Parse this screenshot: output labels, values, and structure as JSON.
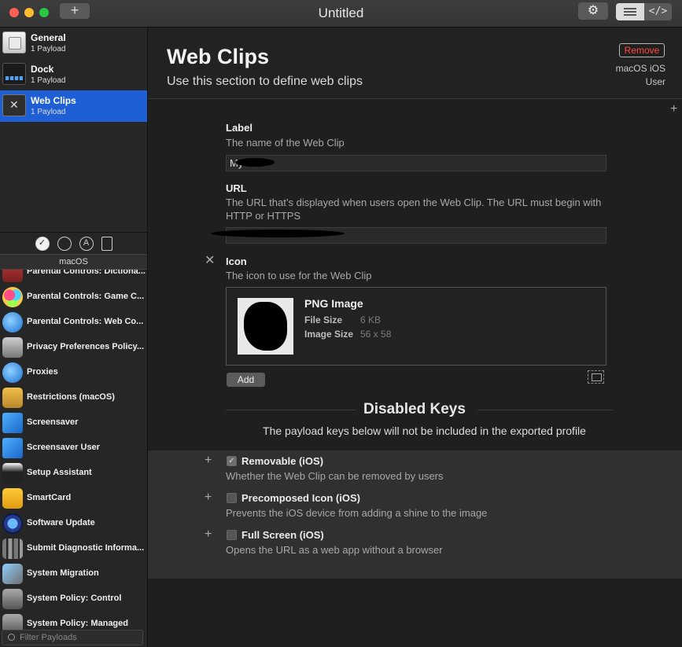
{
  "window": {
    "title": "Untitled",
    "add_label": "+",
    "gear_glyph": "⚙",
    "code_glyph": "</>"
  },
  "payloads": [
    {
      "name": "General",
      "sub": "1 Payload",
      "icon": "general-icon"
    },
    {
      "name": "Dock",
      "sub": "1 Payload",
      "icon": "dock-icon"
    },
    {
      "name": "Web Clips",
      "sub": "1 Payload",
      "icon": "web-clips-icon",
      "selected": true
    }
  ],
  "library": {
    "tabs": [
      "✓",
      "",
      "A",
      ""
    ],
    "platform": "macOS",
    "items": [
      "Parental Controls: Dictiona...",
      "Parental Controls: Game C...",
      "Parental Controls: Web Co...",
      "Privacy Preferences Policy...",
      "Proxies",
      "Restrictions (macOS)",
      "Screensaver",
      "Screensaver User",
      "Setup Assistant",
      "SmartCard",
      "Software Update",
      "Submit Diagnostic Informa...",
      "System Migration",
      "System Policy: Control",
      "System Policy: Managed"
    ],
    "filter_placeholder": "Filter Payloads"
  },
  "header": {
    "title": "Web Clips",
    "subtitle": "Use this section to define web clips",
    "remove_label": "Remove",
    "platforms": "macOS iOS",
    "scope": "User"
  },
  "fields": {
    "label": {
      "title": "Label",
      "desc": "The name of the Web Clip",
      "value": "My"
    },
    "url": {
      "title": "URL",
      "desc": "The URL that’s displayed when users open the Web Clip. The URL must begin with HTTP or HTTPS",
      "value": ""
    },
    "icon": {
      "title": "Icon",
      "desc": "The icon to use for the Web Clip",
      "image_title": "PNG Image",
      "file_size_key": "File Size",
      "file_size_val": "6 KB",
      "image_size_key": "Image Size",
      "image_size_val": "56 x 58",
      "add_label": "Add"
    }
  },
  "disabled_keys": {
    "title": "Disabled Keys",
    "subtitle": "The payload keys below will not be included in the exported profile",
    "items": [
      {
        "name": "Removable (iOS)",
        "desc": "Whether the Web Clip can be removed by users",
        "checked": true
      },
      {
        "name": "Precomposed Icon (iOS)",
        "desc": "Prevents the iOS device from adding a shine to the image",
        "checked": false
      },
      {
        "name": "Full Screen (iOS)",
        "desc": "Opens the URL as a web app without a browser",
        "checked": false
      }
    ]
  },
  "colors": {
    "accent": "#1f5fd6",
    "remove": "#ff4a3d"
  }
}
